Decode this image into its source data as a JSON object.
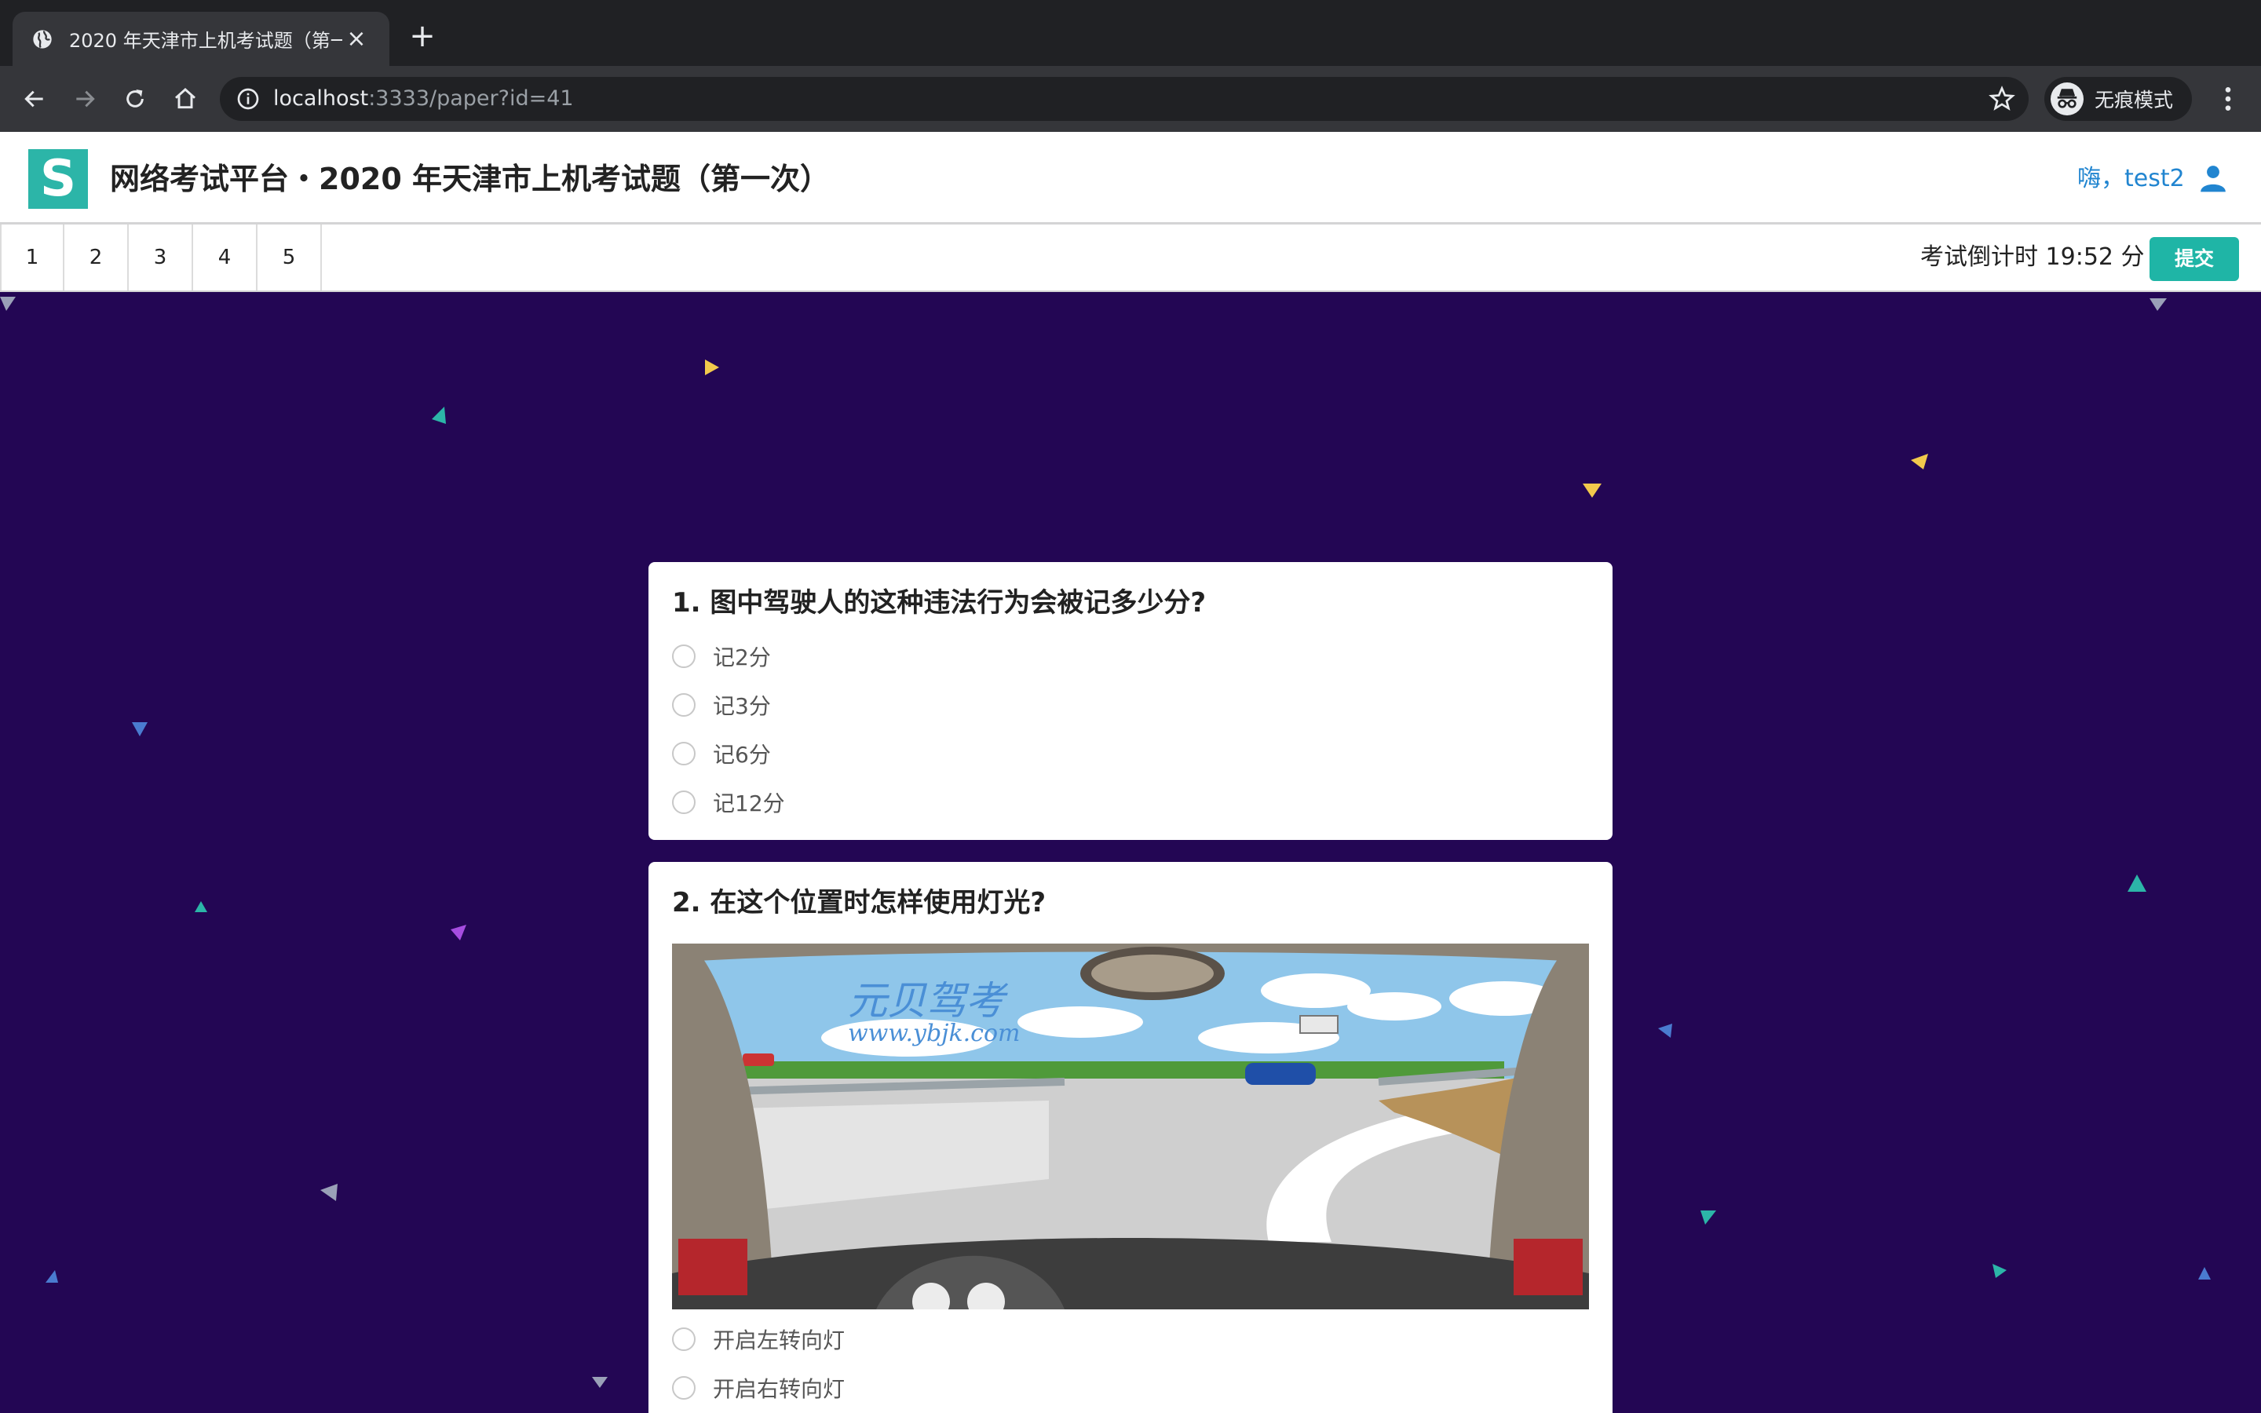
{
  "browser": {
    "tab_title": "2020 年天津市上机考试题（第一次）",
    "new_tab_symbol": "+",
    "close_symbol": "×",
    "url_host": "localhost",
    "url_rest": ":3333/paper?id=41",
    "incognito_label": "无痕模式"
  },
  "app": {
    "logo_letter": "S",
    "title": "网络考试平台・2020 年天津市上机考试题（第一次）",
    "greeting": "嗨，test2"
  },
  "exam_nav": {
    "question_numbers": [
      "1",
      "2",
      "3",
      "4",
      "5"
    ],
    "countdown": "考试倒计时 19:52 分",
    "submit_label": "提交"
  },
  "questions": [
    {
      "title": "1. 图中驾驶人的这种违法行为会被记多少分?",
      "options": [
        "记2分",
        "记3分",
        "记6分",
        "记12分"
      ]
    },
    {
      "title": "2. 在这个位置时怎样使用灯光?",
      "image_watermark": "元贝驾考",
      "image_watermark_url": "www.ybjk.com",
      "options": [
        "开启左转向灯",
        "开启右转向灯"
      ]
    }
  ],
  "colors": {
    "page_background": "#230654",
    "brand_teal": "#1fb5a6",
    "link_blue": "#2185d0"
  },
  "icons": [
    "globe-icon",
    "close-icon",
    "back-icon",
    "forward-icon",
    "reload-icon",
    "home-icon",
    "info-icon",
    "star-icon",
    "incognito-icon",
    "menu-kebab-icon",
    "user-icon",
    "radio-icon"
  ]
}
